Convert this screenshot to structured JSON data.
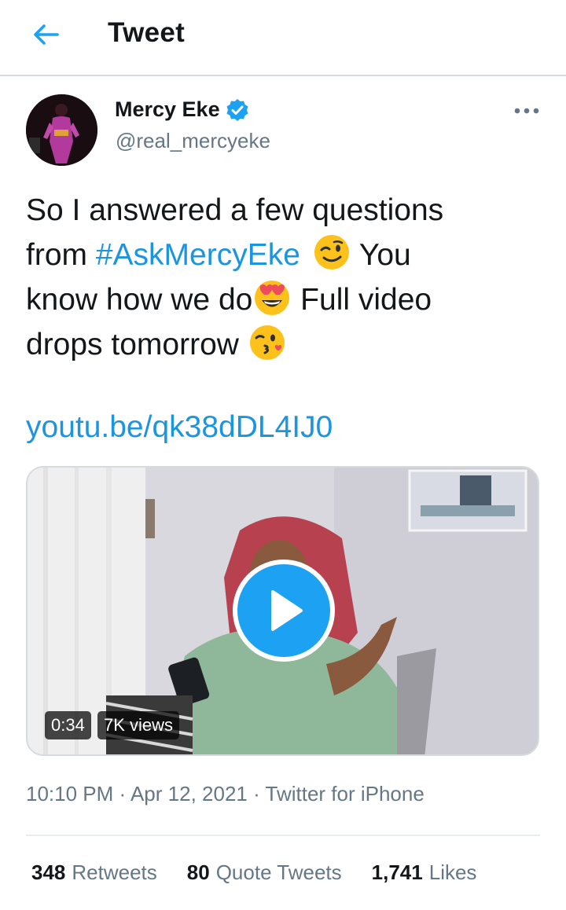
{
  "header": {
    "title": "Tweet",
    "back_icon": "arrow-left-icon"
  },
  "author": {
    "name": "Mercy Eke",
    "handle": "@real_mercyeke",
    "verified": true,
    "verified_color": "#1da1f2"
  },
  "tweet": {
    "line1": "So I answered a few questions",
    "from_text": "from ",
    "hashtag": "#AskMercyEke",
    "after_hashtag": " You",
    "line3": "know how we do",
    "after_line3": " Full video",
    "line4": "drops tomorrow ",
    "link": "youtu.be/qk38dDL4IJ0",
    "emojis": [
      "winking-face-icon",
      "heart-eyes-face-icon",
      "kissing-face-icon"
    ]
  },
  "media": {
    "duration": "0:34",
    "views": "7K views",
    "play_icon": "play-icon"
  },
  "meta": {
    "time": "10:10 PM",
    "date": "Apr 12, 2021",
    "source": "Twitter for iPhone",
    "separator": " · "
  },
  "stats": {
    "retweets": {
      "count": "348",
      "label": "Retweets"
    },
    "quotes": {
      "count": "80",
      "label": "Quote Tweets"
    },
    "likes": {
      "count": "1,741",
      "label": "Likes"
    }
  },
  "colors": {
    "accent": "#1da1f2",
    "link": "#1b95e0",
    "muted": "#657786",
    "text": "#14171a"
  }
}
